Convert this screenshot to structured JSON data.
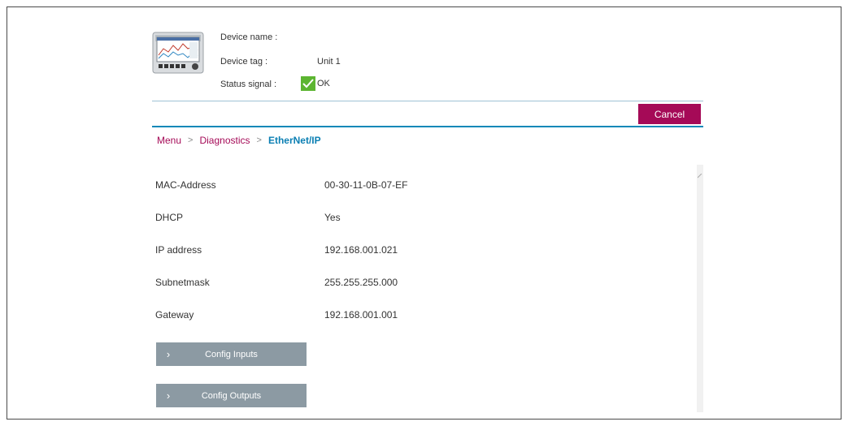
{
  "header": {
    "device_name_label": "Device name :",
    "device_name_value": "",
    "device_tag_label": "Device tag :",
    "device_tag_value": "Unit 1",
    "status_label": "Status signal :",
    "status_value": "OK",
    "status_color": "#5cb531"
  },
  "actions": {
    "cancel_label": "Cancel",
    "accent_color": "#a50a57"
  },
  "breadcrumb": {
    "items": [
      "Menu",
      "Diagnostics"
    ],
    "separator": ">",
    "current": "EtherNet/IP"
  },
  "rows": [
    {
      "label": "MAC-Address",
      "value": "00-30-11-0B-07-EF"
    },
    {
      "label": "DHCP",
      "value": "Yes"
    },
    {
      "label": "IP address",
      "value": "192.168.001.021"
    },
    {
      "label": "Subnetmask",
      "value": "255.255.255.000"
    },
    {
      "label": "Gateway",
      "value": "192.168.001.001"
    }
  ],
  "config_buttons": [
    {
      "label": "Config Inputs",
      "icon": "chevron-right-icon"
    },
    {
      "label": "Config Outputs",
      "icon": "chevron-right-icon"
    }
  ]
}
